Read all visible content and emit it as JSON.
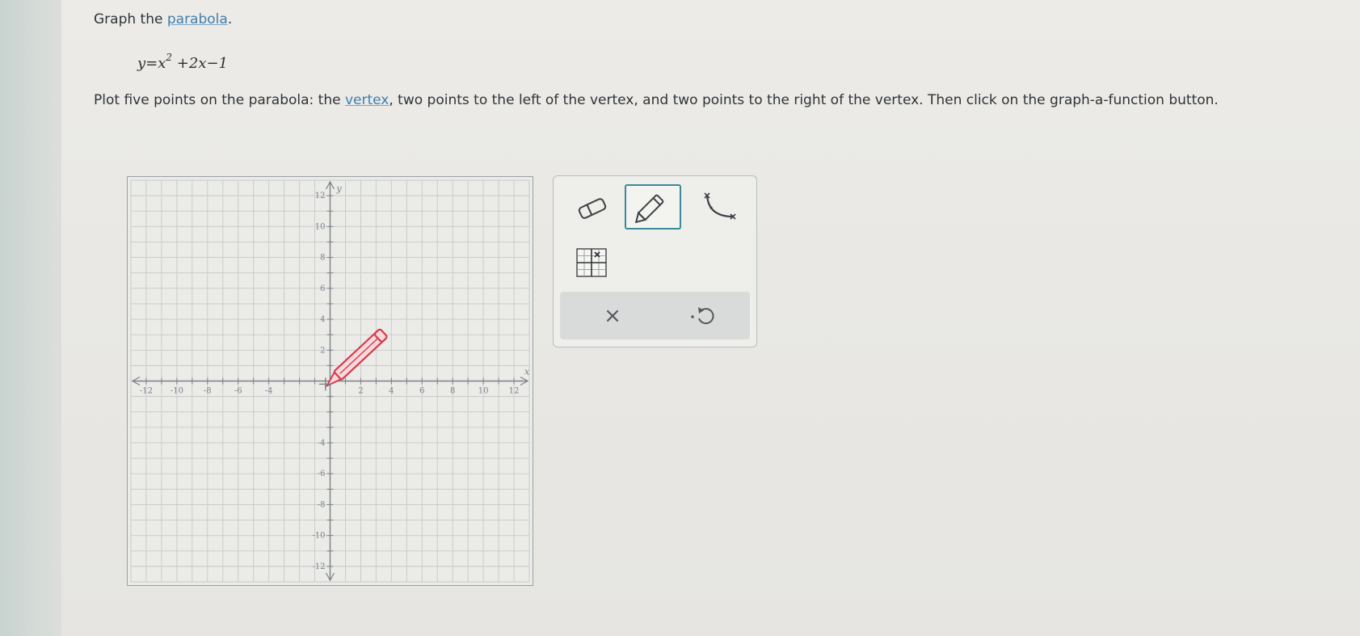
{
  "question": {
    "title_prefix": "Graph the ",
    "title_link": "parabola",
    "title_suffix": ".",
    "equation": {
      "lhs": "y",
      "eq": "=",
      "var": "x",
      "exponent": "2",
      "rest": " +2x−1"
    },
    "instructions": {
      "part1": "Plot five points on the parabola: the ",
      "link": "vertex",
      "part2": ", two points to the left of the vertex, and two points to the right of the vertex. Then click on the graph-a-function button."
    }
  },
  "graph": {
    "x_axis_label": "x",
    "y_axis_label": "y",
    "x_range": [
      -13,
      13
    ],
    "y_range": [
      -13,
      13
    ],
    "x_tick_labels": [
      "-12",
      "-10",
      "-8",
      "-6",
      "-4",
      "2",
      "4",
      "6",
      "8",
      "10",
      "12"
    ],
    "y_tick_labels": [
      "12",
      "10",
      "8",
      "6",
      "4",
      "2",
      "-4",
      "-6",
      "-8",
      "-10",
      "-12"
    ],
    "colors": {
      "grid": "#c6c9cb",
      "axis": "#7c8186",
      "pencil_cursor": "#d63b4a"
    }
  },
  "tools": {
    "eraser_icon": "eraser-icon",
    "pencil_icon": "pencil-icon",
    "curve_icon": "parabola-curve-icon",
    "grid_icon": "graph-function-icon",
    "selected_tool": "pencil",
    "selected_color": "#3c8a98"
  },
  "actions": {
    "clear_label": "×",
    "undo_icon": "undo-icon"
  }
}
